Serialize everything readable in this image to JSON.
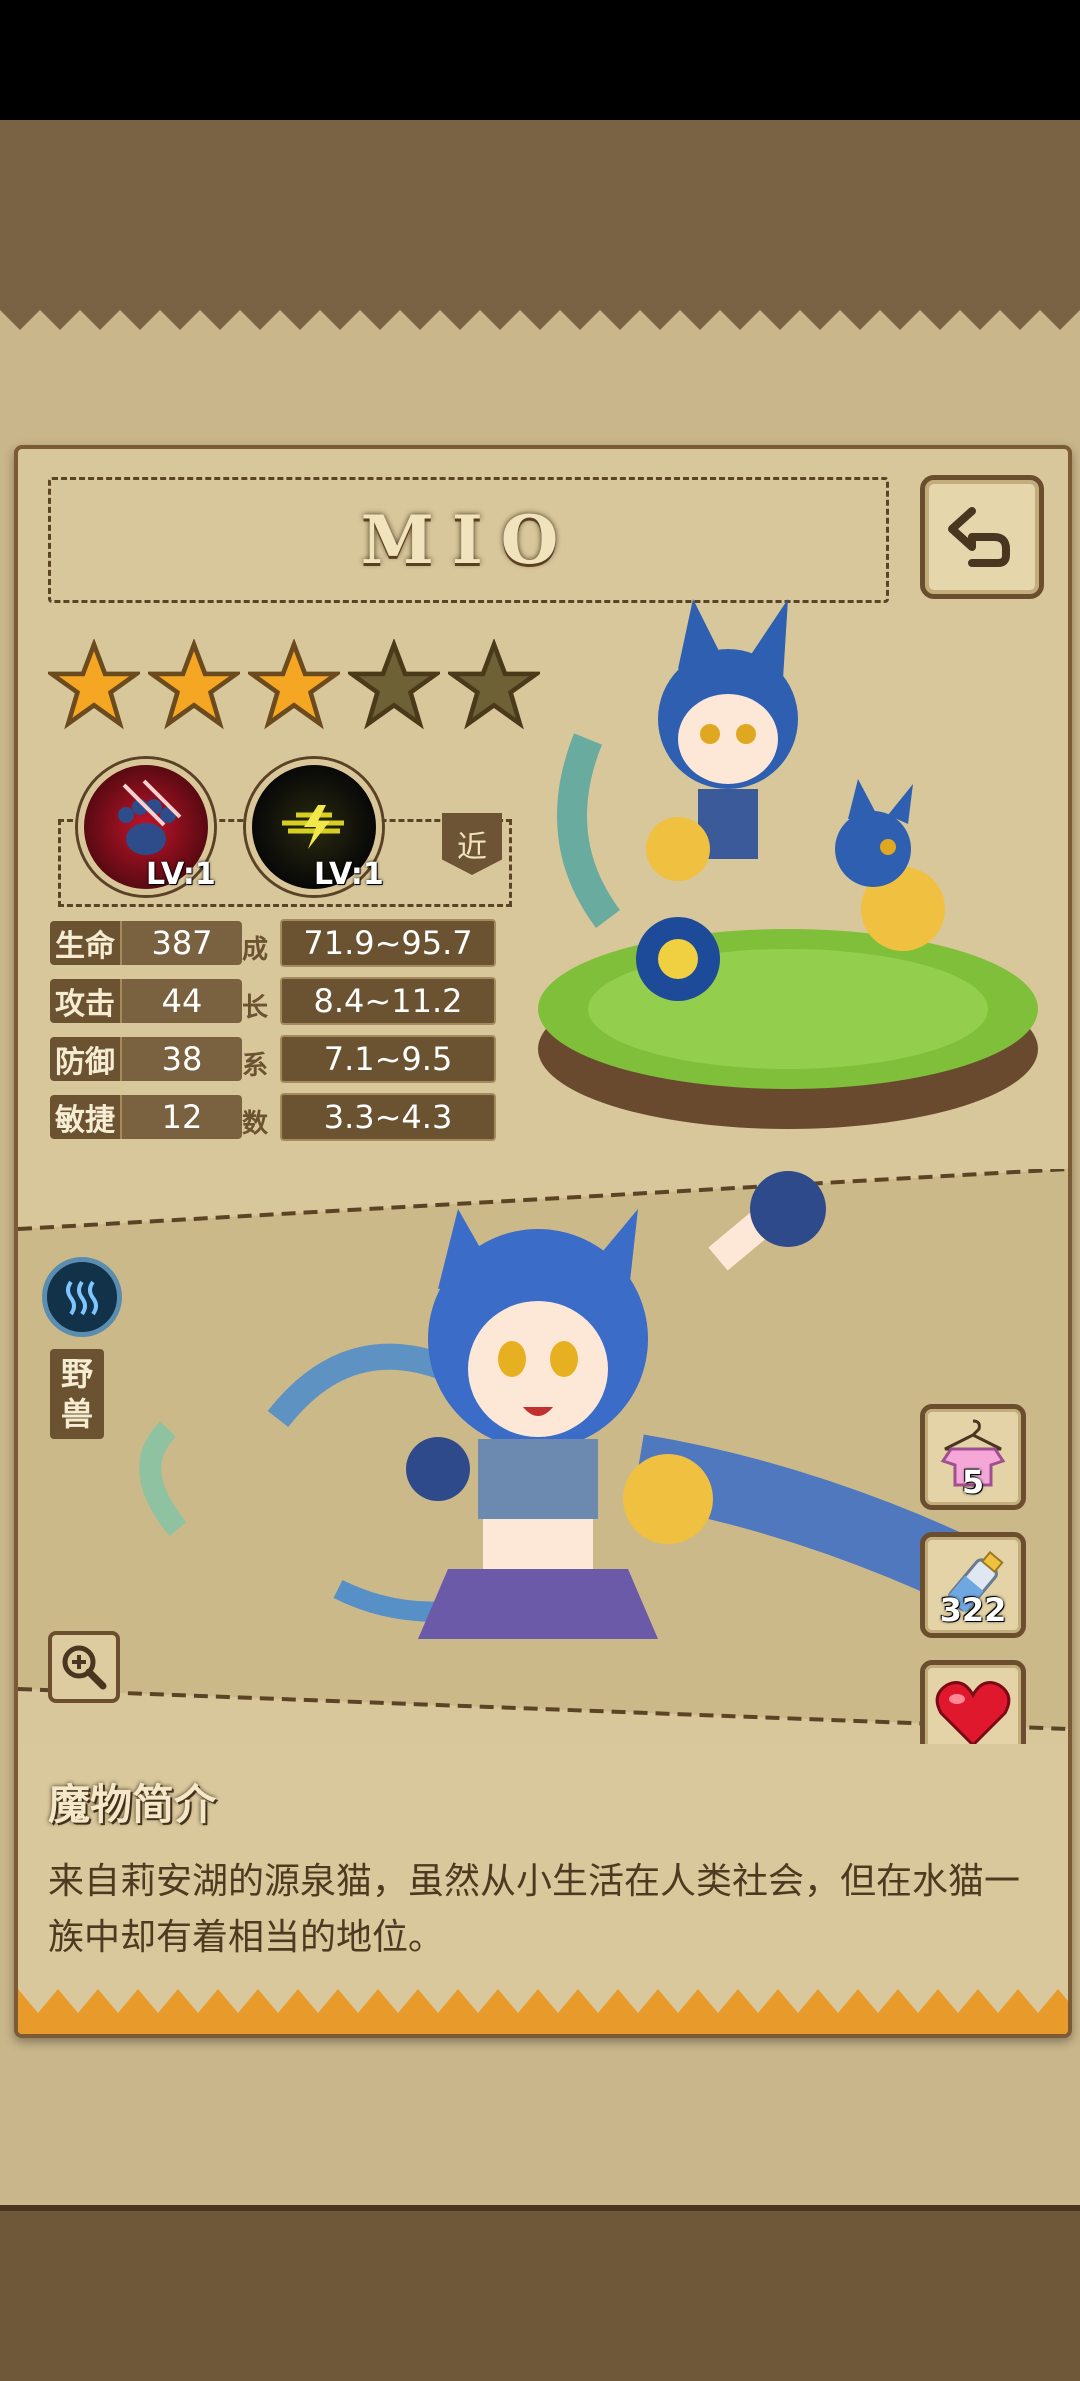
{
  "monster": {
    "name": "MIO",
    "stars_filled": 3,
    "stars_total": 5
  },
  "skills": [
    {
      "icon": "paw-claw-icon",
      "level": "LV:1"
    },
    {
      "icon": "lightning-icon",
      "level": "LV:1"
    }
  ],
  "range_badge": "近",
  "stats": [
    {
      "name": "生命",
      "value": "387",
      "growth": "71.9~95.7"
    },
    {
      "name": "攻击",
      "value": "44",
      "growth": "8.4~11.2"
    },
    {
      "name": "防御",
      "value": "38",
      "growth": "7.1~9.5"
    },
    {
      "name": "敏捷",
      "value": "12",
      "growth": "3.3~4.3"
    }
  ],
  "growth_label": [
    "成",
    "长",
    "系",
    "数"
  ],
  "element_icon": "water-icon",
  "type_tag": [
    "野",
    "兽"
  ],
  "side_buttons": {
    "outfit": {
      "icon": "outfit-hanger-icon",
      "count": "5"
    },
    "bottle": {
      "icon": "milk-bottle-icon",
      "count": "322"
    },
    "favorite": {
      "icon": "heart-icon"
    }
  },
  "description": {
    "title": "魔物简介",
    "text": "来自莉安湖的源泉猫，虽然从小生活在人类社会，但在水猫一族中却有着相当的地位。"
  },
  "colors": {
    "paper": "#d8c79b",
    "frame": "#7a5b35",
    "label_bg": "#6b5332",
    "star": "#f5a623",
    "water": "#3a86d4"
  }
}
